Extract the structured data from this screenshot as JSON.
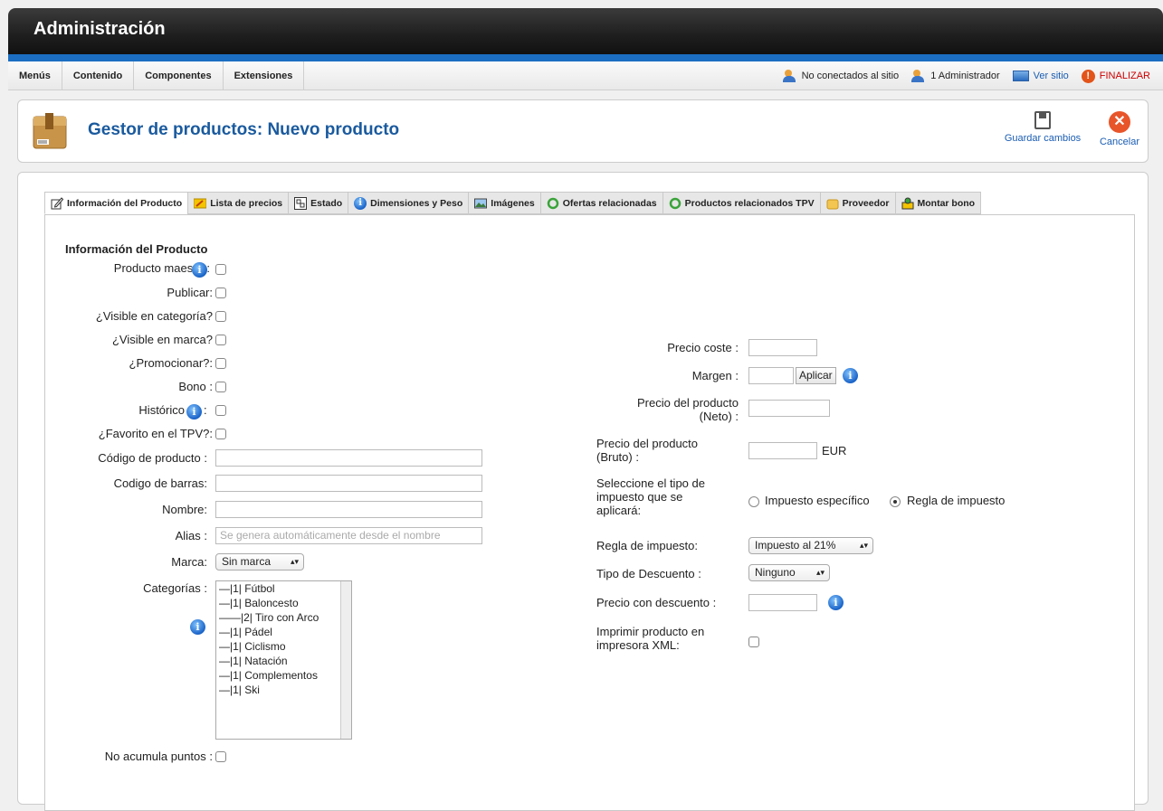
{
  "header": {
    "title": "Administración"
  },
  "menu": {
    "items": [
      "Menús",
      "Contenido",
      "Componentes",
      "Extensiones"
    ]
  },
  "status": {
    "visitors": "No conectados al sitio",
    "admins": "1 Administrador",
    "view_site": "Ver sitio",
    "logout": "FINALIZAR"
  },
  "toolbar": {
    "title": "Gestor de productos: Nuevo producto",
    "save_label": "Guardar cambios",
    "cancel_label": "Cancelar"
  },
  "tabs": [
    "Información del Producto",
    "Lista de precios",
    "Estado",
    "Dimensiones y Peso",
    "Imágenes",
    "Ofertas relacionadas",
    "Productos relacionados TPV",
    "Proveedor",
    "Montar bono"
  ],
  "form": {
    "section_title": "Información del Producto",
    "labels": {
      "master": "Producto maestro:",
      "publish": "Publicar:",
      "visible_category": "¿Visible en categoría?",
      "visible_brand": "¿Visible en marca?",
      "promote": "¿Promocionar?:",
      "voucher": "Bono :",
      "history": "Histórico",
      "history_colon": ":",
      "favorite": "¿Favorito en el TPV?:",
      "code": "Código de producto :",
      "barcode": "Codigo de barras:",
      "name": "Nombre:",
      "alias": "Alias :",
      "brand": "Marca:",
      "categories": "Categorías :",
      "no_points": "No acumula puntos :"
    },
    "alias_placeholder": "Se genera automáticamente desde el nombre",
    "brand_value": "Sin marca",
    "categories": [
      "—|1| Fútbol",
      "—|1| Baloncesto",
      "——|2| Tiro con Arco",
      "—|1| Pádel",
      "—|1| Ciclismo",
      "—|1| Natación",
      "—|1| Complementos",
      "—|1| Ski"
    ]
  },
  "pricing": {
    "cost_label": "Precio coste :",
    "margin_label": "Margen :",
    "apply_label": "Aplicar",
    "net_label_1": "Precio del producto",
    "net_label_2": "(Neto) :",
    "gross_label_1": "Precio del producto",
    "gross_label_2": "(Bruto) :",
    "currency": "EUR",
    "tax_type_1": "Seleccione el tipo de",
    "tax_type_2": "impuesto que se",
    "tax_type_3": "aplicará:",
    "tax_specific": "Impuesto específico",
    "tax_rule_option": "Regla de impuesto",
    "tax_rule_label": "Regla de impuesto:",
    "tax_rule_value": "Impuesto al 21%",
    "discount_type_label": "Tipo de Descuento :",
    "discount_type_value": "Ninguno",
    "discount_price_label": "Precio con descuento :",
    "print_label_1": "Imprimir producto en",
    "print_label_2": "impresora XML:"
  }
}
